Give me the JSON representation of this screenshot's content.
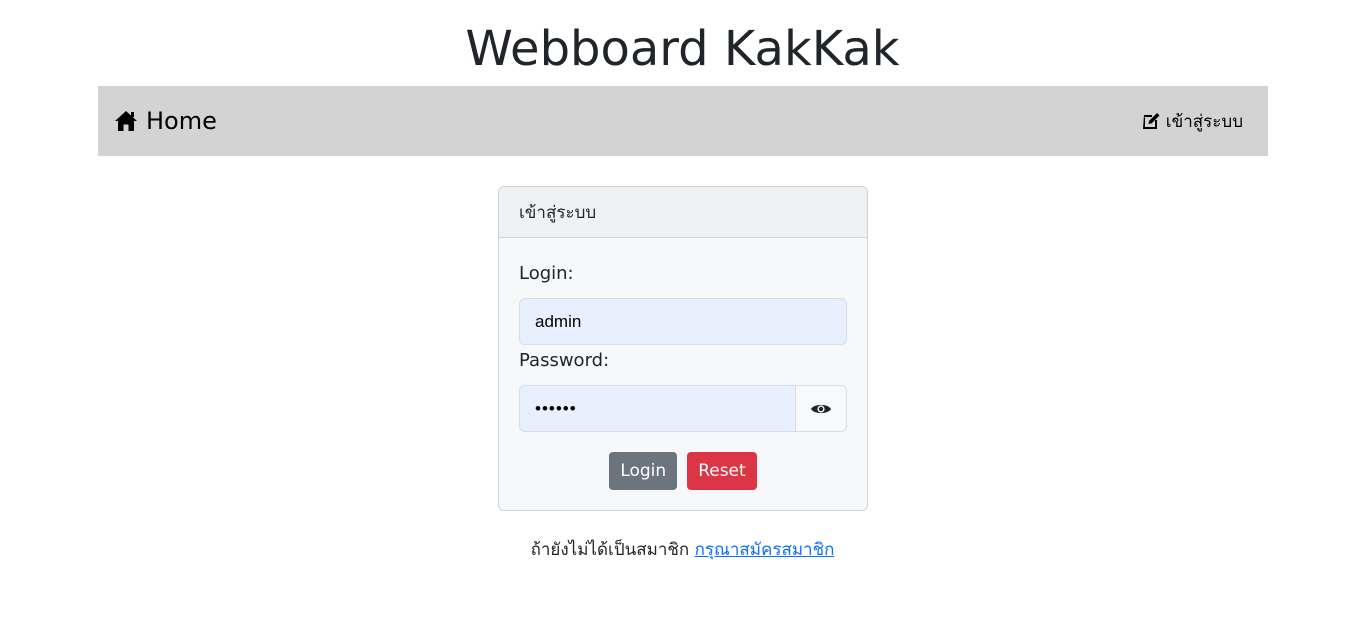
{
  "site": {
    "title": "Webboard KakKak"
  },
  "navbar": {
    "home_label": "Home",
    "home_icon": "house-icon",
    "login_label": "เข้าสู่ระบบ",
    "login_icon": "pencil-square-icon",
    "background": "#d3d3d3"
  },
  "login_card": {
    "header": "เข้าสู่ระบบ",
    "login_label": "Login:",
    "login_value": "admin",
    "password_label": "Password:",
    "password_value": "secret",
    "toggle_icon": "eye-icon",
    "login_button": "Login",
    "reset_button": "Reset"
  },
  "footer": {
    "prompt": "ถ้ายังไม่ได้เป็นสมาชิก",
    "register_link": "กรุณาสมัครสมาชิก"
  },
  "colors": {
    "login_button": "#6c757d",
    "reset_button": "#dc3545",
    "link": "#0d6efd",
    "input_autofill": "#e8f0fe"
  }
}
